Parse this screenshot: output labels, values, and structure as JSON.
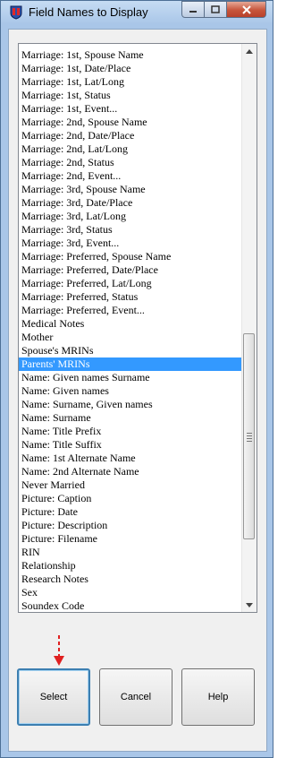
{
  "window": {
    "title": "Field Names to Display",
    "icons": {
      "app": "app-shield-icon",
      "minimize": "minimize-icon",
      "maximize": "maximize-icon",
      "close": "close-icon"
    }
  },
  "list": {
    "items": [
      "Marriage: 1st, Spouse Name",
      "Marriage: 1st, Date/Place",
      "Marriage: 1st, Lat/Long",
      "Marriage: 1st, Status",
      "Marriage: 1st, Event...",
      "Marriage: 2nd, Spouse Name",
      "Marriage: 2nd, Date/Place",
      "Marriage: 2nd, Lat/Long",
      "Marriage: 2nd, Status",
      "Marriage: 2nd, Event...",
      "Marriage: 3rd, Spouse Name",
      "Marriage: 3rd, Date/Place",
      "Marriage: 3rd, Lat/Long",
      "Marriage: 3rd, Status",
      "Marriage: 3rd, Event...",
      "Marriage: Preferred, Spouse Name",
      "Marriage: Preferred, Date/Place",
      "Marriage: Preferred, Lat/Long",
      "Marriage: Preferred, Status",
      "Marriage: Preferred, Event...",
      "Medical Notes",
      "Mother",
      "Spouse's MRINs",
      "Parents' MRINs",
      "Name: Given names Surname",
      "Name: Given names",
      "Name: Surname, Given names",
      "Name: Surname",
      "Name: Title Prefix",
      "Name: Title Suffix",
      "Name: 1st Alternate Name",
      "Name: 2nd Alternate Name",
      "Never Married",
      "Picture: Caption",
      "Picture: Date",
      "Picture: Description",
      "Picture: Filename",
      "RIN",
      "Relationship",
      "Research Notes",
      "Sex",
      "Soundex Code"
    ],
    "selected_index": 23
  },
  "buttons": {
    "select": "Select",
    "cancel": "Cancel",
    "help": "Help"
  },
  "annotation": {
    "arrow_color": "#e02020",
    "points_to": "select"
  },
  "colors": {
    "selection": "#3399ff",
    "titlebar": "#a9c6e8"
  }
}
